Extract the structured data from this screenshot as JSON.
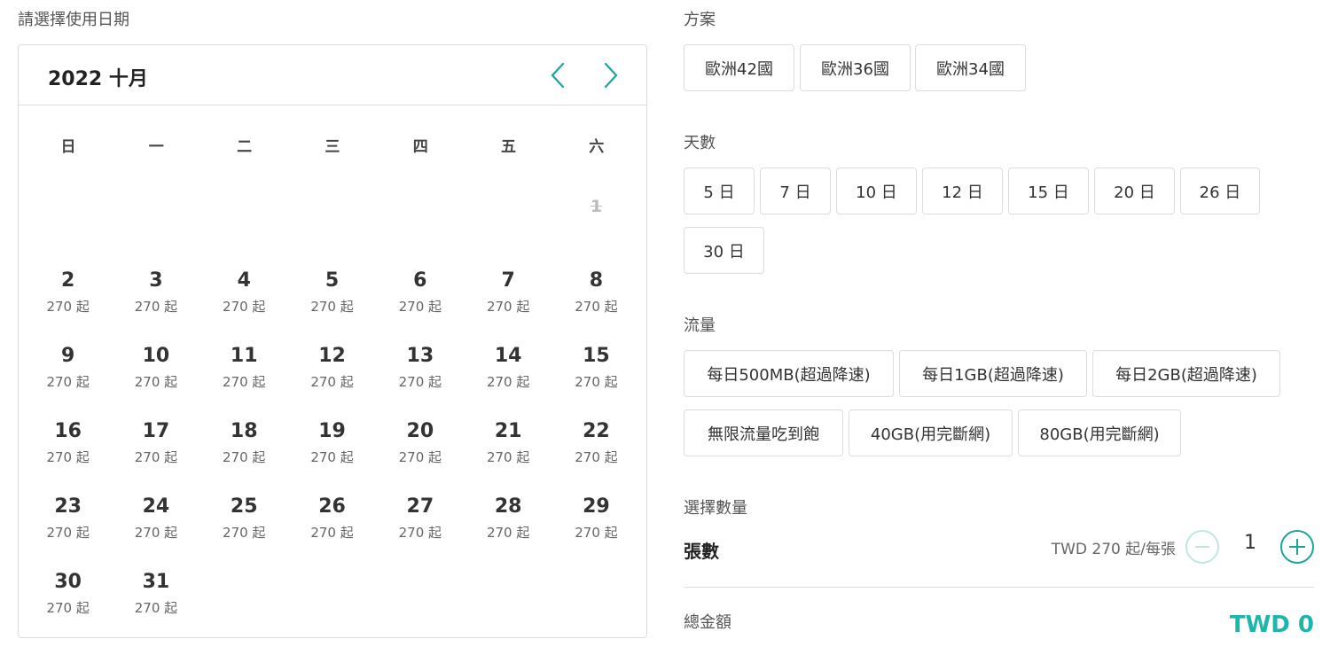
{
  "date_label": "請選擇使用日期",
  "calendar": {
    "month_title": "2022 十月",
    "weekdays": [
      "日",
      "一",
      "二",
      "三",
      "四",
      "五",
      "六"
    ],
    "days": [
      {
        "num": "1",
        "price": "",
        "disabled": true
      },
      {
        "num": "2",
        "price": "270 起"
      },
      {
        "num": "3",
        "price": "270 起"
      },
      {
        "num": "4",
        "price": "270 起"
      },
      {
        "num": "5",
        "price": "270 起"
      },
      {
        "num": "6",
        "price": "270 起"
      },
      {
        "num": "7",
        "price": "270 起"
      },
      {
        "num": "8",
        "price": "270 起"
      },
      {
        "num": "9",
        "price": "270 起"
      },
      {
        "num": "10",
        "price": "270 起"
      },
      {
        "num": "11",
        "price": "270 起"
      },
      {
        "num": "12",
        "price": "270 起"
      },
      {
        "num": "13",
        "price": "270 起"
      },
      {
        "num": "14",
        "price": "270 起"
      },
      {
        "num": "15",
        "price": "270 起"
      },
      {
        "num": "16",
        "price": "270 起"
      },
      {
        "num": "17",
        "price": "270 起"
      },
      {
        "num": "18",
        "price": "270 起"
      },
      {
        "num": "19",
        "price": "270 起"
      },
      {
        "num": "20",
        "price": "270 起"
      },
      {
        "num": "21",
        "price": "270 起"
      },
      {
        "num": "22",
        "price": "270 起"
      },
      {
        "num": "23",
        "price": "270 起"
      },
      {
        "num": "24",
        "price": "270 起"
      },
      {
        "num": "25",
        "price": "270 起"
      },
      {
        "num": "26",
        "price": "270 起"
      },
      {
        "num": "27",
        "price": "270 起"
      },
      {
        "num": "28",
        "price": "270 起"
      },
      {
        "num": "29",
        "price": "270 起"
      },
      {
        "num": "30",
        "price": "270 起"
      },
      {
        "num": "31",
        "price": "270 起"
      }
    ],
    "first_weekday": 6
  },
  "plan": {
    "label": "方案",
    "options": [
      "歐洲42國",
      "歐洲36國",
      "歐洲34國"
    ]
  },
  "days_option": {
    "label": "天數",
    "options": [
      "5 日",
      "7 日",
      "10 日",
      "12 日",
      "15 日",
      "20 日",
      "26 日",
      "30 日"
    ]
  },
  "data_option": {
    "label": "流量",
    "options": [
      "每日500MB(超過降速)",
      "每日1GB(超過降速)",
      "每日2GB(超過降速)",
      "無限流量吃到飽",
      "40GB(用完斷網)",
      "80GB(用完斷網)"
    ]
  },
  "quantity": {
    "label": "選擇數量",
    "title": "張數",
    "unit_price": "TWD 270 起/每張",
    "value": "1"
  },
  "total": {
    "label": "總金額",
    "value": "TWD 0"
  },
  "colors": {
    "accent": "#1aa59b",
    "total": "#1fb5ac",
    "border": "#dcdcdc"
  }
}
